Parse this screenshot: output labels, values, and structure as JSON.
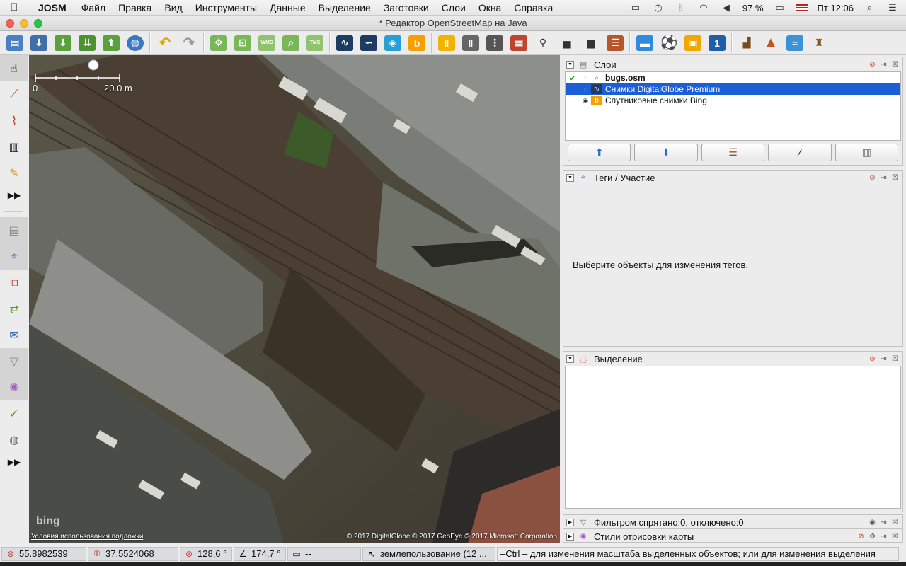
{
  "menubar": {
    "app": "JOSM",
    "menus": [
      "Файл",
      "Правка",
      "Вид",
      "Инструменты",
      "Данные",
      "Выделение",
      "Заготовки",
      "Слои",
      "Окна",
      "Справка"
    ],
    "battery": "97 %",
    "clock": "Пт 12:06"
  },
  "window": {
    "title": "* Редактор OpenStreetMap на Java"
  },
  "map": {
    "scale_start": "0",
    "scale_end": "20.0 m",
    "attribution_logo": "bing",
    "terms": "Условия использования подложки",
    "copyright": "© 2017 DigitalGlobe © 2017 GeoEye © 2017 Microsoft Corporation"
  },
  "layers_panel": {
    "title": "Слои",
    "layers": [
      {
        "name": "bugs.osm",
        "selected": false,
        "bold": true
      },
      {
        "name": "Снимки DigitalGlobe Premium",
        "selected": true,
        "bold": false
      },
      {
        "name": "Спутниковые снимки Bing",
        "selected": false,
        "bold": false
      }
    ]
  },
  "tags_panel": {
    "title": "Теги / Участие",
    "empty_message": "Выберите объекты для изменения тегов."
  },
  "selection_panel": {
    "title": "Выделение"
  },
  "filter_panel": {
    "title": "Фильтром спрятано:0, отключено:0"
  },
  "styles_panel": {
    "title": "Стили отрисовки карты"
  },
  "statusbar": {
    "lat": "55.8982539",
    "lon": "37.5524068",
    "heading": "128,6 °",
    "angle": "174,7 °",
    "distance": "--",
    "object": "землепользование (12 ...",
    "help": "–Ctrl – для изменения масштаба выделенных объектов; или для изменения выделения"
  },
  "colors": {
    "selection": "#1a5ed8",
    "map_bg": "#4d4a3e",
    "toolbar_bg": "#ececec"
  }
}
